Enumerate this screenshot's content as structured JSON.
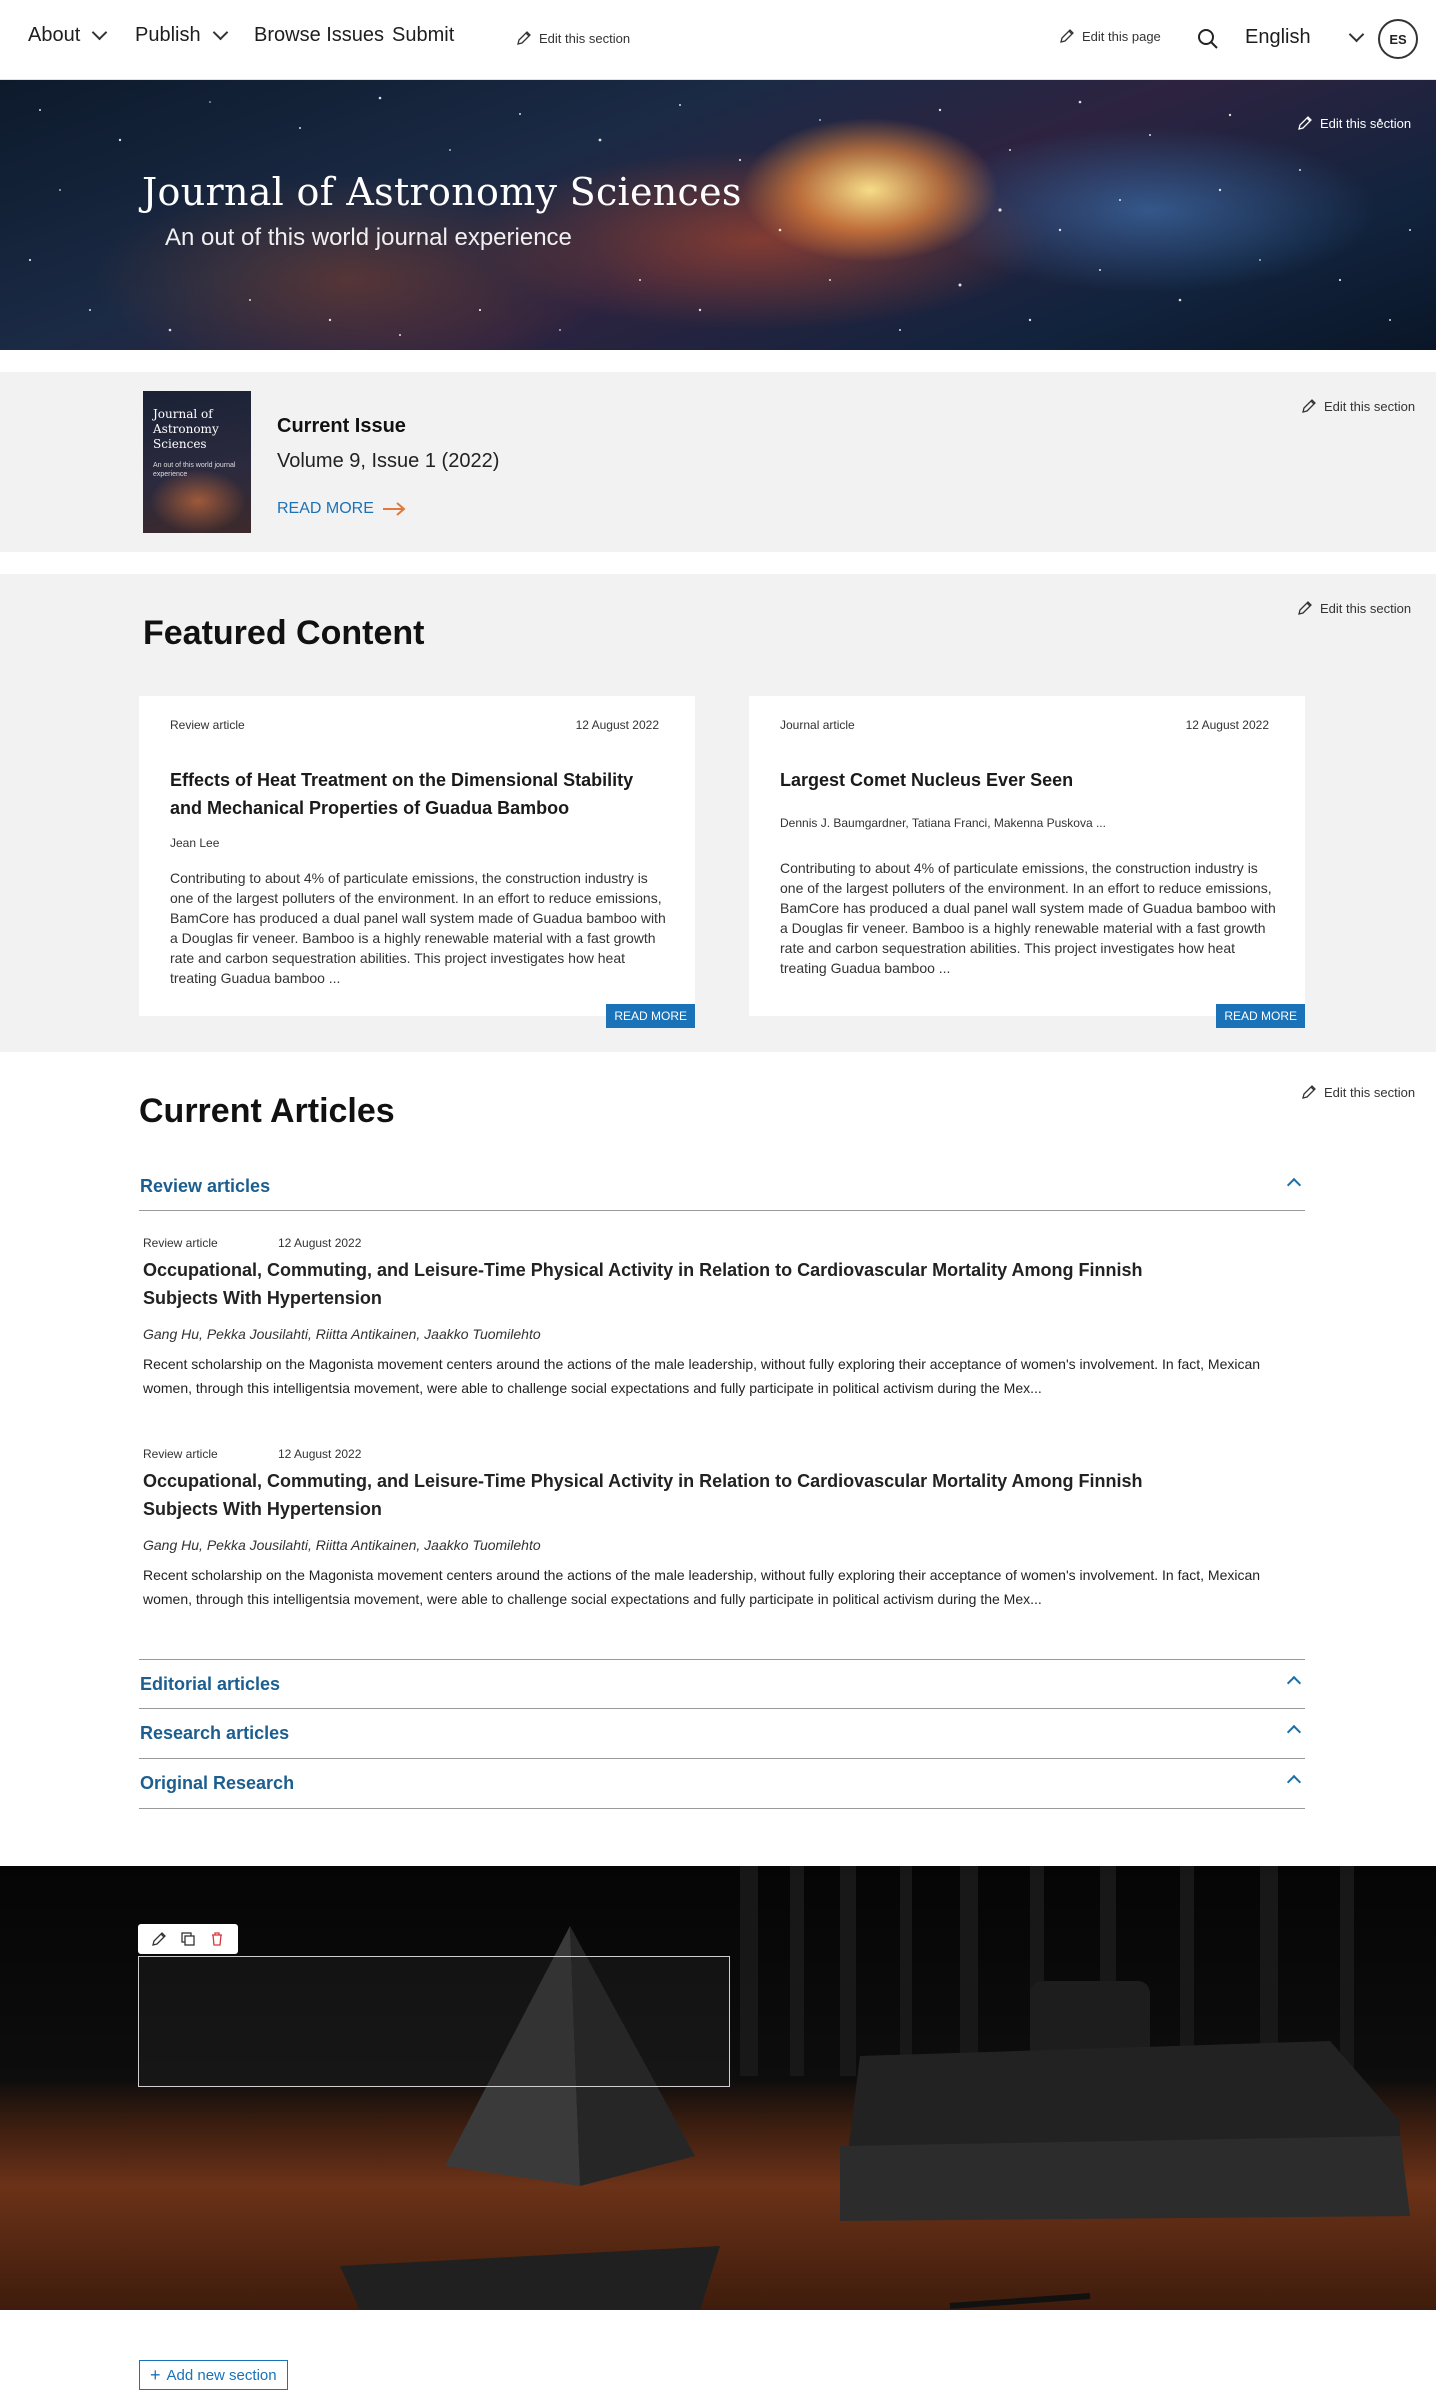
{
  "nav": {
    "items": [
      {
        "label": "About",
        "has_dropdown": true
      },
      {
        "label": "Publish",
        "has_dropdown": true
      },
      {
        "label": "Browse Issues",
        "has_dropdown": false
      },
      {
        "label": "Submit",
        "has_dropdown": false
      }
    ],
    "edit_section": "Edit this section",
    "edit_page": "Edit this page",
    "language": "English",
    "avatar_initials": "ES"
  },
  "hero": {
    "title": "Journal of Astronomy Sciences",
    "subtitle": "An out of this world journal experience",
    "edit_section": "Edit this section"
  },
  "current_issue": {
    "cover_title": "Journal of Astronomy Sciences",
    "cover_subtitle": "An out of this world journal experience",
    "label": "Current Issue",
    "volume": "Volume 9, Issue 1 (2022)",
    "read_more": "READ MORE",
    "edit_section": "Edit this section"
  },
  "featured": {
    "title": "Featured Content",
    "edit_section": "Edit this section",
    "cards": [
      {
        "type": "Review article",
        "date": "12 August 2022",
        "title": "Effects of Heat Treatment on the Dimensional Stability and Mechanical Properties of Guadua Bamboo",
        "authors": "Jean Lee",
        "body": "Contributing to about 4% of particulate emissions, the construction industry is one of the largest polluters of the environment. In an effort to reduce emissions, BamCore has produced a dual panel wall system made of Guadua bamboo with a Douglas fir veneer. Bamboo is a highly renewable material with a fast growth rate and carbon sequestration abilities. This project investigates how heat treating Guadua bamboo ...",
        "button": "READ MORE"
      },
      {
        "type": "Journal article",
        "date": "12 August 2022",
        "title": "Largest Comet Nucleus Ever Seen",
        "authors": "Dennis J. Baumgardner, Tatiana Franci, Makenna Puskova ...",
        "body": "Contributing to about 4% of particulate emissions, the construction industry is one of the largest polluters of the environment. In an effort to reduce emissions, BamCore has produced a dual panel wall system made of Guadua bamboo with a Douglas fir veneer. Bamboo is a highly renewable material with a fast growth rate and carbon sequestration abilities. This project investigates how heat treating Guadua bamboo ...",
        "button": "READ MORE"
      }
    ]
  },
  "current_articles": {
    "title": "Current Articles",
    "edit_section": "Edit this section",
    "sections": [
      {
        "label": "Review articles",
        "expanded": true
      },
      {
        "label": "Editorial articles",
        "expanded": false
      },
      {
        "label": "Research articles",
        "expanded": false
      },
      {
        "label": "Original Research",
        "expanded": false
      }
    ],
    "articles": [
      {
        "type": "Review article",
        "date": "12 August 2022",
        "title": "Occupational, Commuting, and Leisure-Time Physical Activity in Relation to Cardiovascular Mortality Among Finnish Subjects With Hypertension",
        "authors": "Gang Hu, Pekka Jousilahti, Riitta Antikainen, Jaakko Tuomilehto",
        "body": "Recent scholarship on the Magonista movement centers around the actions of the male leadership, without fully exploring their acceptance of women's involvement. In fact, Mexican women, through this intelligentsia movement, were able to challenge social expectations and fully participate in political activism during the Mex..."
      },
      {
        "type": "Review article",
        "date": "12 August 2022",
        "title": "Occupational, Commuting, and Leisure-Time Physical Activity in Relation to Cardiovascular Mortality Among Finnish Subjects With Hypertension",
        "authors": "Gang Hu, Pekka Jousilahti, Riitta Antikainen, Jaakko Tuomilehto",
        "body": "Recent scholarship on the Magonista movement centers around the actions of the male leadership, without fully exploring their acceptance of women's involvement. In fact, Mexican women, through this intelligentsia movement, were able to challenge social expectations and fully participate in political activism during the Mex..."
      }
    ]
  },
  "editor": {
    "add_section": "Add new section",
    "toolbar_icons": [
      "pencil-icon",
      "duplicate-icon",
      "trash-icon"
    ]
  },
  "colors": {
    "accent_blue": "#1a72b8",
    "heading_blue": "#1b5e8f",
    "arrow_orange": "#e07a3a",
    "delete_red": "#d9363e",
    "panel_gray": "#f2f2f2"
  }
}
